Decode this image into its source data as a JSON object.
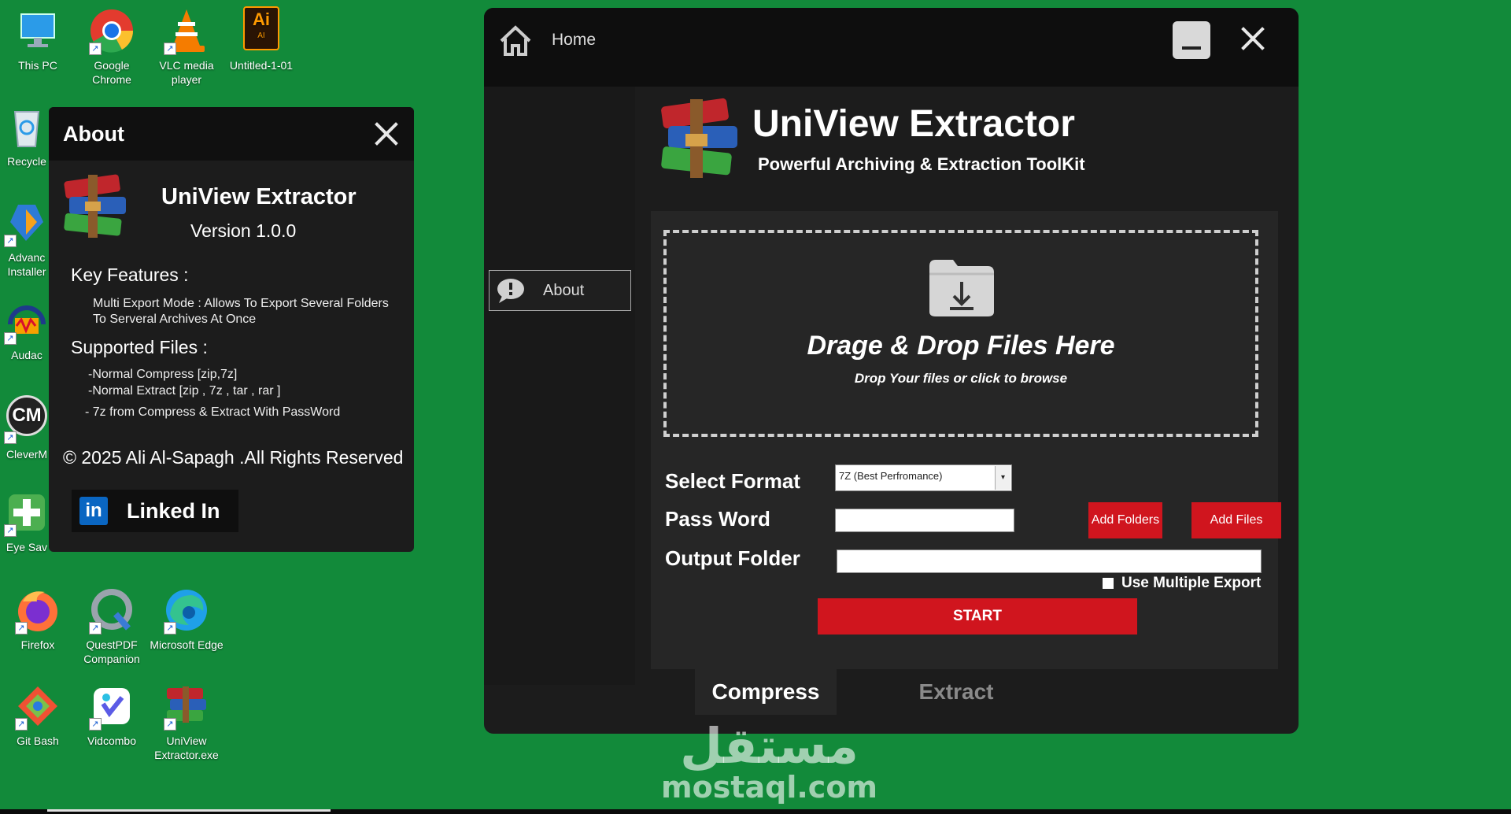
{
  "desktop": {
    "icons": [
      {
        "label": "This PC"
      },
      {
        "label": "Google Chrome"
      },
      {
        "label": "VLC media player"
      },
      {
        "label": "Untitled-1-01"
      },
      {
        "label": "Recycle"
      },
      {
        "label": "Advanc Installer"
      },
      {
        "label": "Audac"
      },
      {
        "label": "CleverM"
      },
      {
        "label": "Eye Sav"
      },
      {
        "label": "Firefox"
      },
      {
        "label": "QuestPDF Companion"
      },
      {
        "label": "Microsoft Edge"
      },
      {
        "label": "Git Bash"
      },
      {
        "label": "Vidcombo"
      },
      {
        "label": "UniView Extractor.exe"
      }
    ],
    "ai_badge": "Ai",
    "ai_badge_small": "AI"
  },
  "about": {
    "title": "About",
    "app_name": "UniView Extractor",
    "version": "Version 1.0.0",
    "key_features_heading": "Key Features :",
    "feature_line1": "Multi Export Mode   : Allows To Export Several Folders",
    "feature_line2": "To Serveral Archives At Once",
    "supported_heading": "Supported Files :",
    "supported_1": "-Normal Compress [zip,7z]",
    "supported_2": "-Normal Extract [zip , 7z , tar , rar ]",
    "supported_3": "- 7z from Compress & Extract With PassWord",
    "rights": "© 2025 Ali Al-Sapagh .All Rights Reserved",
    "linkedin_icon": "in",
    "linkedin_label": "Linked In"
  },
  "main": {
    "home_label": "Home",
    "sidebar_about": "About",
    "app_name": "UniView Extractor",
    "tagline": "Powerful Archiving &  Extraction ToolKit",
    "drop_title": "Drage & Drop Files Here",
    "drop_sub": "Drop Your files or click to browse",
    "select_format_label": "Select Format",
    "format_value": "7Z (Best Perfromance)",
    "password_label": "Pass Word",
    "output_label": "Output Folder",
    "add_folders": "Add Folders",
    "add_files": "Add Files",
    "multiple_export": "Use Multiple Export",
    "multiple_export_checked": false,
    "start": "START",
    "tabs": [
      "Compress",
      "Extract"
    ],
    "active_tab": "Compress"
  },
  "watermark": {
    "arabic": "مستقل",
    "latin": "mostaql.com"
  },
  "colors": {
    "desktop_bg": "#128a3a",
    "accent_red": "#d0151e",
    "window_bg": "#1c1c1c"
  }
}
